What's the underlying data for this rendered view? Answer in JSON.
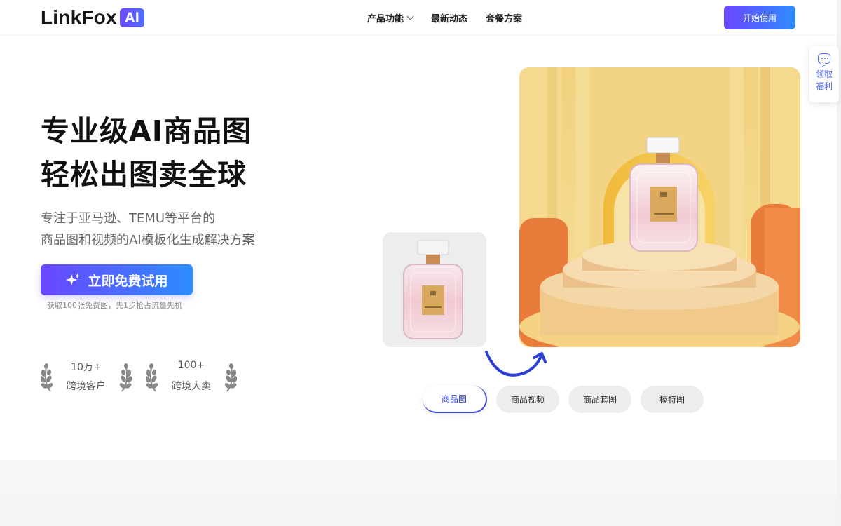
{
  "header": {
    "logo_text": "LinkFox",
    "logo_badge": "AI",
    "nav": [
      {
        "label": "产品功能",
        "dropdown": true
      },
      {
        "label": "最新动态",
        "dropdown": false
      },
      {
        "label": "套餐方案",
        "dropdown": false
      }
    ],
    "start_button": "开始使用"
  },
  "welfare": {
    "label": "领取福利",
    "icon": "chat-icon"
  },
  "hero": {
    "title_line1": "专业级AI商品图",
    "title_line2": "轻松出图卖全球",
    "subtitle_line1": "专注于亚马逊、TEMU等平台的",
    "subtitle_line2": "商品图和视频的AI模板化生成解决方案",
    "cta_label": "立即免费试用",
    "cta_icon": "sparkle-icon",
    "cta_note": "获取100张免费图，先1步抢占流量先机",
    "stats": [
      {
        "number": "10万+",
        "label": "跨境客户"
      },
      {
        "number": "100+",
        "label": "跨境大卖"
      }
    ]
  },
  "showcase": {
    "tabs": [
      {
        "label": "商品图",
        "active": true
      },
      {
        "label": "商品视频",
        "active": false
      },
      {
        "label": "商品套图",
        "active": false
      },
      {
        "label": "模特图",
        "active": false
      }
    ]
  },
  "colors": {
    "accent_start": "#6b46ff",
    "accent_end": "#2d8cff",
    "tab_active_text": "#2a3cd8"
  }
}
